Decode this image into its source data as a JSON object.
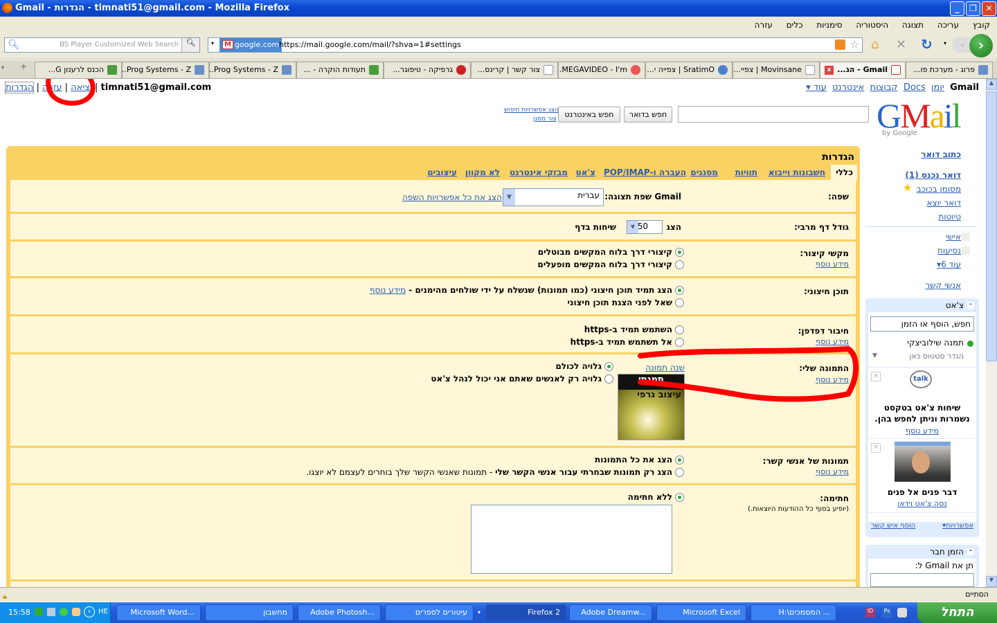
{
  "window": {
    "title": "Gmail - הגדרות - timnati51@gmail.com - Mozilla Firefox"
  },
  "menu": [
    "קובץ",
    "עריכה",
    "תצוגה",
    "היסטוריה",
    "סימניות",
    "כלים",
    "עזרה"
  ],
  "toolbar": {
    "search_placeholder": "BS Player Customized Web Search",
    "site_badge": "google.com",
    "url": "https://mail.google.com/mail/?shva=1#settings"
  },
  "tabs": [
    {
      "label": "פרוג - מערכת פו...",
      "active": false,
      "color": "#6a8fc8"
    },
    {
      "label": "Gmail - הג...",
      "active": true,
      "color": "#d44"
    },
    {
      "label": "Movinsane | צפיי...",
      "active": false,
      "color": "#fff"
    },
    {
      "label": "SratimO | צפייה י...",
      "active": false,
      "color": "#4a7fcf"
    },
    {
      "label": "MEGAVIDEO - I'm...",
      "active": false,
      "color": "#e55"
    },
    {
      "label": "צור קשר | קרינס...",
      "active": false,
      "color": "#fff"
    },
    {
      "label": "גרפיקה - טיפוגר...",
      "active": false,
      "color": "#c22"
    },
    {
      "label": "תעודות הוקרה - ...",
      "active": false,
      "color": "#4a9d3a"
    },
    {
      "label": "Prog Systems - Z...",
      "active": false,
      "color": "#6a8fc8"
    },
    {
      "label": "Prog Systems - Z...",
      "active": false,
      "color": "#6a8fc8"
    },
    {
      "label": "הכנס לרענון G...",
      "active": false,
      "color": "#4a9d3a"
    }
  ],
  "gbar": {
    "brand": "Gmail",
    "links": [
      "יומן",
      "Docs",
      "קבוצות",
      "אינטרנט",
      "עוד ▾"
    ]
  },
  "user": {
    "email": "timnati51@gmail.com",
    "settings": "הגדרות",
    "help": "עזרה",
    "signout": "יציאה"
  },
  "search": {
    "mail_button": "חפש בדואר",
    "web_button": "חפש באינטרנט",
    "options_link": "הצג אפשרויות חיפוש",
    "filter_link": "צור מסנן"
  },
  "logo": {
    "text": "Gmail",
    "by": "by Google"
  },
  "nav": {
    "compose": "כתוב דואר",
    "inbox": "דואר נכנס (1)",
    "starred": "מסומן בכוכב",
    "sent": "דואר יוצא",
    "drafts": "טיוטות",
    "labels": [
      "אישי",
      "נסיעות"
    ],
    "more_labels": "עוד 6▾",
    "contacts": "אנשי קשר"
  },
  "chat": {
    "title": "צ'אט",
    "search_placeholder": "חפש, הוסף או הזמן",
    "user_name": "תמנה שילוביצקי",
    "status": "הגדר סטטוס כאן",
    "promo1": "שיחות צ'אט בטקסט נשמרות וניתן לחפש בהן.",
    "promo1_link": "מידע נוסף",
    "talk_logo": "talk",
    "promo2": "דבר פנים אל פנים",
    "promo2_link": "נסה צ'אט וידאו",
    "options": "אפשרויות▾",
    "add_contact": "הוסף איש קשר"
  },
  "invite": {
    "title": "הזמן חבר",
    "label": "תן את Gmail ל:"
  },
  "settings": {
    "title": "הגדרות",
    "tabs": [
      "כללי",
      "חשבונות וייבוא",
      "תוויות",
      "מסננים",
      "העברה ו-POP/IMAP",
      "צ'אט",
      "מבזקי אינטרנט",
      "לא מקוון",
      "עיצובים"
    ],
    "more_info": "מידע נוסף",
    "language": {
      "label": "שפה:",
      "text": "Gmail שפת תצוגה:",
      "value": "עברית",
      "link": "הצג את כל אפשרויות השפה"
    },
    "page_size": {
      "label": "גודל דף מרבי:",
      "show": "הצג",
      "value": "50",
      "suffix": "שיחות בדף"
    },
    "shortcuts": {
      "label": "מקשי קיצור:",
      "options": [
        "קיצורי דרך בלוח המקשים מבוטלים",
        "קיצורי דרך בלוח המקשים מופעלים"
      ],
      "selected": 0
    },
    "external": {
      "label": "תוכן חיצוני:",
      "options": [
        "הצג תמיד תוכן חיצוני (כמו תמונות) שנשלח על ידי שולחים מהימנים -",
        "שאל לפני הצגת תוכן חיצוני"
      ],
      "selected": 0
    },
    "browser": {
      "label": "חיבור דפדפן:",
      "options": [
        "השתמש תמיד ב-https",
        "אל תשתמש תמיד ב-https"
      ],
      "selected": -1
    },
    "picture": {
      "label": "התמונה שלי:",
      "change": "שנה תמונה",
      "image_text": "עיצוב גרפי",
      "image_title": "תמנתי",
      "options": [
        "גלויה לכולם",
        "גלויה רק לאנשים שאתם אני יכול לנהל צ'אט"
      ],
      "selected": 0
    },
    "contact_pics": {
      "label": "תמונות של אנשי קשר:",
      "options": [
        "הצג את כל התמונות",
        "הצג רק תמונות שבחרתי עבור אנשי הקשר שלי"
      ],
      "note": " - תמונות שאנשי הקשר שלך בוחרים לעצמם לא יוצגו.",
      "selected": 0
    },
    "signature": {
      "label": "חתימה:",
      "note": "(יופיע בסוף כל ההודעות היוצאות.)",
      "option": "ללא חתימה",
      "selected": 0
    }
  },
  "status": {
    "text": "הסתיים"
  },
  "taskbar": {
    "start": "התחל",
    "items": [
      "H:\\המסמכים ...",
      "Microsoft Excel",
      "Adobe Dreamw...",
      "Firefox 2",
      "עיטורים לספרים",
      "Adobe Photosh...",
      "מחשבון",
      "Microsoft Word..."
    ],
    "lang": "HE",
    "clock": "15:58"
  },
  "colors": {
    "settings_yellow": "#fad163",
    "settings_bg": "#fff7d7",
    "link": "#2a5db0",
    "annotation": "#ff0000"
  }
}
